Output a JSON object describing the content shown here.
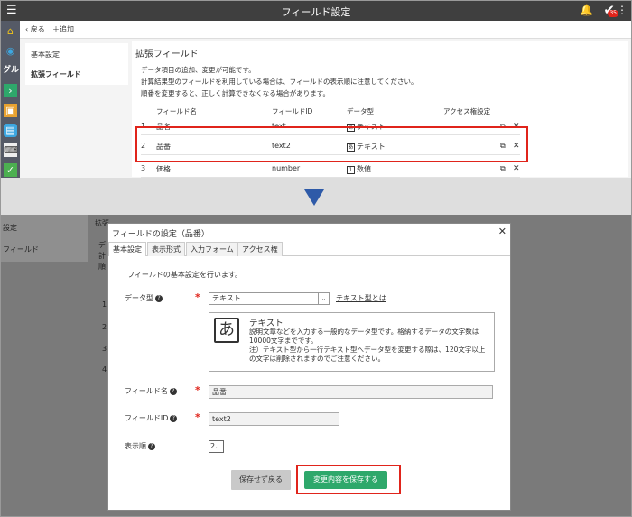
{
  "top": {
    "window_title": "フィールド設定",
    "toolbar": {
      "back": "戻る",
      "add": "追加"
    },
    "rail_text": "グル",
    "badge": "35",
    "nav": {
      "basic": "基本設定",
      "extended": "拡張フィールド"
    },
    "heading": "拡張フィールド",
    "desc": [
      "データ項目の追加、変更が可能です。",
      "計算結果型のフィールドを利用している場合は、フィールドの表示順に注意してください。",
      "順番を変更すると、正しく計算できなくなる場合があります。"
    ],
    "columns": {
      "name": "フィールド名",
      "id": "フィールドID",
      "type": "データ型",
      "access": "アクセス権設定"
    },
    "rows": [
      {
        "num": "1",
        "name": "品名",
        "id": "text",
        "type_glyph": "あ",
        "type": "テキスト"
      },
      {
        "num": "2",
        "name": "品番",
        "id": "text2",
        "type_glyph": "あ",
        "type": "テキスト"
      },
      {
        "num": "3",
        "name": "価格",
        "id": "number",
        "type_glyph": "1",
        "type": "数値"
      }
    ]
  },
  "bg": {
    "nav1": "設定",
    "nav2": "フィールド",
    "h": "拡張",
    "d1": "デ",
    "d2": "計",
    "d3": "順",
    "n1": "1",
    "n2": "2",
    "n3": "3",
    "n4": "4"
  },
  "dialog": {
    "title": "フィールドの設定（品番）",
    "tabs": [
      "基本設定",
      "表示形式",
      "入力フォーム",
      "アクセス権"
    ],
    "intro": "フィールドの基本設定を行います。",
    "data_type_label": "データ型",
    "data_type_value": "テキスト",
    "data_type_link": "テキスト型とは",
    "type_glyph": "あ",
    "type_name": "テキスト",
    "type_desc": "説明文章などを入力する一般的なデータ型です。格納するデータの文字数は10000文字までです。\n注）テキスト型から一行テキスト型へデータ型を変更する際は、120文字以上の文字は削除されますのでご注意ください。",
    "field_name_label": "フィールド名",
    "field_name_value": "品番",
    "field_id_label": "フィールドID",
    "field_id_value": "text2",
    "order_label": "表示順",
    "order_value": "2",
    "cancel_label": "保存せず戻る",
    "save_label": "変更内容を保存する"
  },
  "colors": {
    "accent_green": "#2ea86b",
    "highlight_red": "#e0241b",
    "arrow_blue": "#2e5aa8"
  }
}
